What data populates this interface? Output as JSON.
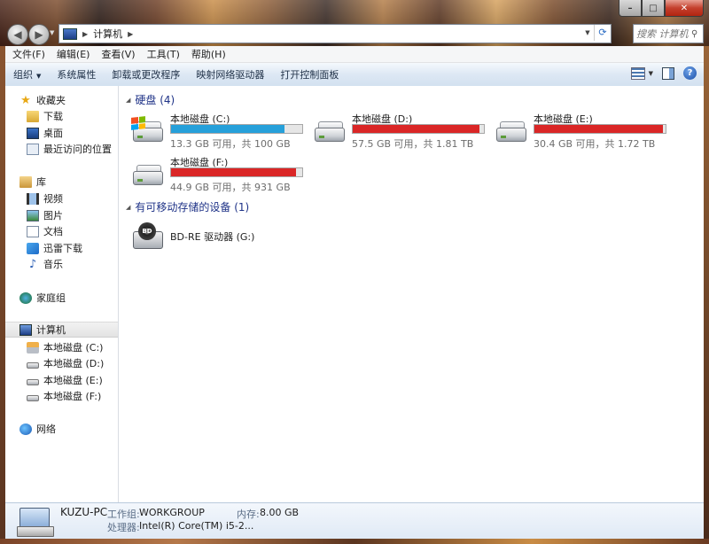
{
  "window": {
    "buttons": {
      "minimize": "–",
      "maximize": "□",
      "close": "✕"
    }
  },
  "nav": {
    "back_icon": "back-arrow-icon",
    "forward_icon": "forward-arrow-icon",
    "breadcrumb": "计算机",
    "search_placeholder": "搜索 计算机"
  },
  "menubar": [
    "文件(F)",
    "编辑(E)",
    "查看(V)",
    "工具(T)",
    "帮助(H)"
  ],
  "toolbar": {
    "organize": "组织",
    "system_properties": "系统属性",
    "uninstall": "卸载或更改程序",
    "map_drive": "映射网络驱动器",
    "control_panel": "打开控制面板",
    "help": "?"
  },
  "sidebar": {
    "favorites": {
      "label": "收藏夹",
      "items": [
        "下载",
        "桌面",
        "最近访问的位置"
      ]
    },
    "libraries": {
      "label": "库",
      "items": [
        "视频",
        "图片",
        "文档",
        "迅雷下载",
        "音乐"
      ]
    },
    "homegroup": "家庭组",
    "computer": {
      "label": "计算机",
      "items": [
        "本地磁盘 (C:)",
        "本地磁盘 (D:)",
        "本地磁盘 (E:)",
        "本地磁盘 (F:)"
      ]
    },
    "network": "网络"
  },
  "main": {
    "hdd_group": {
      "title": "硬盘 (4)",
      "drives": [
        {
          "name": "本地磁盘 (C:)",
          "info": "13.3 GB 可用，共 100 GB",
          "used_fraction": 0.867,
          "bar_color": "#26a0da"
        },
        {
          "name": "本地磁盘 (D:)",
          "info": "57.5 GB 可用，共 1.81 TB",
          "used_fraction": 0.969,
          "bar_color": "#da2626"
        },
        {
          "name": "本地磁盘 (E:)",
          "info": "30.4 GB 可用，共 1.72 TB",
          "used_fraction": 0.983,
          "bar_color": "#da2626"
        },
        {
          "name": "本地磁盘 (F:)",
          "info": "44.9 GB 可用，共 931 GB",
          "used_fraction": 0.952,
          "bar_color": "#da2626"
        }
      ]
    },
    "removable_group": {
      "title": "有可移动存储的设备 (1)",
      "devices": [
        {
          "name": "BD-RE 驱动器 (G:)",
          "icon": "bd-drive-icon"
        }
      ]
    }
  },
  "details": {
    "pc_name": "KUZU-PC",
    "workgroup_label": "工作组:",
    "workgroup": "WORKGROUP",
    "memory_label": "内存:",
    "memory": "8.00 GB",
    "processor_label": "处理器:",
    "processor": "Intel(R) Core(TM) i5-2..."
  }
}
